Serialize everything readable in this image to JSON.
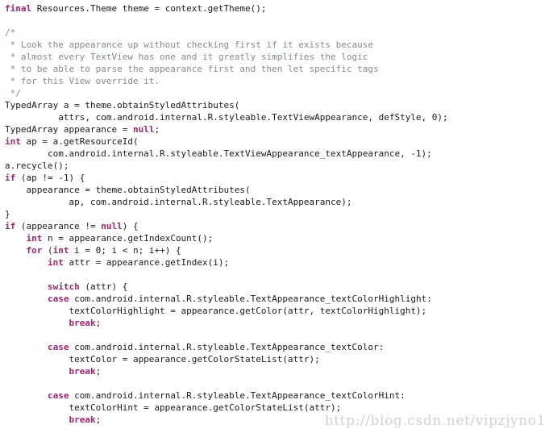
{
  "editor": {
    "language": "java",
    "background_color": "#ffffff",
    "plain_color": "#1a1a1a",
    "keyword_color": "#a0246e",
    "comment_color": "#808f80",
    "font_size_px": 11,
    "line_height_px": 15
  },
  "watermark": {
    "text": "http://blog.csdn.net/vipzjyno1",
    "color": "#d2d2d2"
  },
  "code": {
    "lines": [
      [
        {
          "t": "final",
          "c": "kw"
        },
        {
          "t": " Resources.Theme theme = context.getTheme();",
          "c": "pln"
        }
      ],
      [
        {
          "t": "",
          "c": "pln"
        }
      ],
      [
        {
          "t": "/*",
          "c": "cmt"
        }
      ],
      [
        {
          "t": " * Look the appearance up without checking first if it exists because",
          "c": "cmt"
        }
      ],
      [
        {
          "t": " * almost every TextView has one and it greatly simplifies the logic",
          "c": "cmt"
        }
      ],
      [
        {
          "t": " * to be able to parse the appearance first and then let specific tags",
          "c": "cmt"
        }
      ],
      [
        {
          "t": " * for this View override it.",
          "c": "cmt"
        }
      ],
      [
        {
          "t": " */",
          "c": "cmt"
        }
      ],
      [
        {
          "t": "TypedArray a = theme.obtainStyledAttributes(",
          "c": "pln"
        }
      ],
      [
        {
          "t": "          attrs, com.android.internal.R.styleable.TextViewAppearance, defStyle, 0);",
          "c": "pln"
        }
      ],
      [
        {
          "t": "TypedArray appearance = ",
          "c": "pln"
        },
        {
          "t": "null",
          "c": "kw"
        },
        {
          "t": ";",
          "c": "pln"
        }
      ],
      [
        {
          "t": "int",
          "c": "kw"
        },
        {
          "t": " ap = a.getResourceId(",
          "c": "pln"
        }
      ],
      [
        {
          "t": "        com.android.internal.R.styleable.TextViewAppearance_textAppearance, -1);",
          "c": "pln"
        }
      ],
      [
        {
          "t": "a.recycle();",
          "c": "pln"
        }
      ],
      [
        {
          "t": "if",
          "c": "kw"
        },
        {
          "t": " (ap != -1) {",
          "c": "pln"
        }
      ],
      [
        {
          "t": "    appearance = theme.obtainStyledAttributes(",
          "c": "pln"
        }
      ],
      [
        {
          "t": "            ap, com.android.internal.R.styleable.TextAppearance);",
          "c": "pln"
        }
      ],
      [
        {
          "t": "}",
          "c": "pln"
        }
      ],
      [
        {
          "t": "if",
          "c": "kw"
        },
        {
          "t": " (appearance != ",
          "c": "pln"
        },
        {
          "t": "null",
          "c": "kw"
        },
        {
          "t": ") {",
          "c": "pln"
        }
      ],
      [
        {
          "t": "    ",
          "c": "pln"
        },
        {
          "t": "int",
          "c": "kw"
        },
        {
          "t": " n = appearance.getIndexCount();",
          "c": "pln"
        }
      ],
      [
        {
          "t": "    ",
          "c": "pln"
        },
        {
          "t": "for",
          "c": "kw"
        },
        {
          "t": " (",
          "c": "pln"
        },
        {
          "t": "int",
          "c": "kw"
        },
        {
          "t": " i = 0; i < n; i++) {",
          "c": "pln"
        }
      ],
      [
        {
          "t": "        ",
          "c": "pln"
        },
        {
          "t": "int",
          "c": "kw"
        },
        {
          "t": " attr = appearance.getIndex(i);",
          "c": "pln"
        }
      ],
      [
        {
          "t": "",
          "c": "pln"
        }
      ],
      [
        {
          "t": "        ",
          "c": "pln"
        },
        {
          "t": "switch",
          "c": "kw"
        },
        {
          "t": " (attr) {",
          "c": "pln"
        }
      ],
      [
        {
          "t": "        ",
          "c": "pln"
        },
        {
          "t": "case",
          "c": "kw"
        },
        {
          "t": " com.android.internal.R.styleable.TextAppearance_textColorHighlight:",
          "c": "pln"
        }
      ],
      [
        {
          "t": "            textColorHighlight = appearance.getColor(attr, textColorHighlight);",
          "c": "pln"
        }
      ],
      [
        {
          "t": "            ",
          "c": "pln"
        },
        {
          "t": "break",
          "c": "kw"
        },
        {
          "t": ";",
          "c": "pln"
        }
      ],
      [
        {
          "t": "",
          "c": "pln"
        }
      ],
      [
        {
          "t": "        ",
          "c": "pln"
        },
        {
          "t": "case",
          "c": "kw"
        },
        {
          "t": " com.android.internal.R.styleable.TextAppearance_textColor:",
          "c": "pln"
        }
      ],
      [
        {
          "t": "            textColor = appearance.getColorStateList(attr);",
          "c": "pln"
        }
      ],
      [
        {
          "t": "            ",
          "c": "pln"
        },
        {
          "t": "break",
          "c": "kw"
        },
        {
          "t": ";",
          "c": "pln"
        }
      ],
      [
        {
          "t": "",
          "c": "pln"
        }
      ],
      [
        {
          "t": "        ",
          "c": "pln"
        },
        {
          "t": "case",
          "c": "kw"
        },
        {
          "t": " com.android.internal.R.styleable.TextAppearance_textColorHint:",
          "c": "pln"
        }
      ],
      [
        {
          "t": "            textColorHint = appearance.getColorStateList(attr);",
          "c": "pln"
        }
      ],
      [
        {
          "t": "            ",
          "c": "pln"
        },
        {
          "t": "break",
          "c": "kw"
        },
        {
          "t": ";",
          "c": "pln"
        }
      ]
    ]
  }
}
